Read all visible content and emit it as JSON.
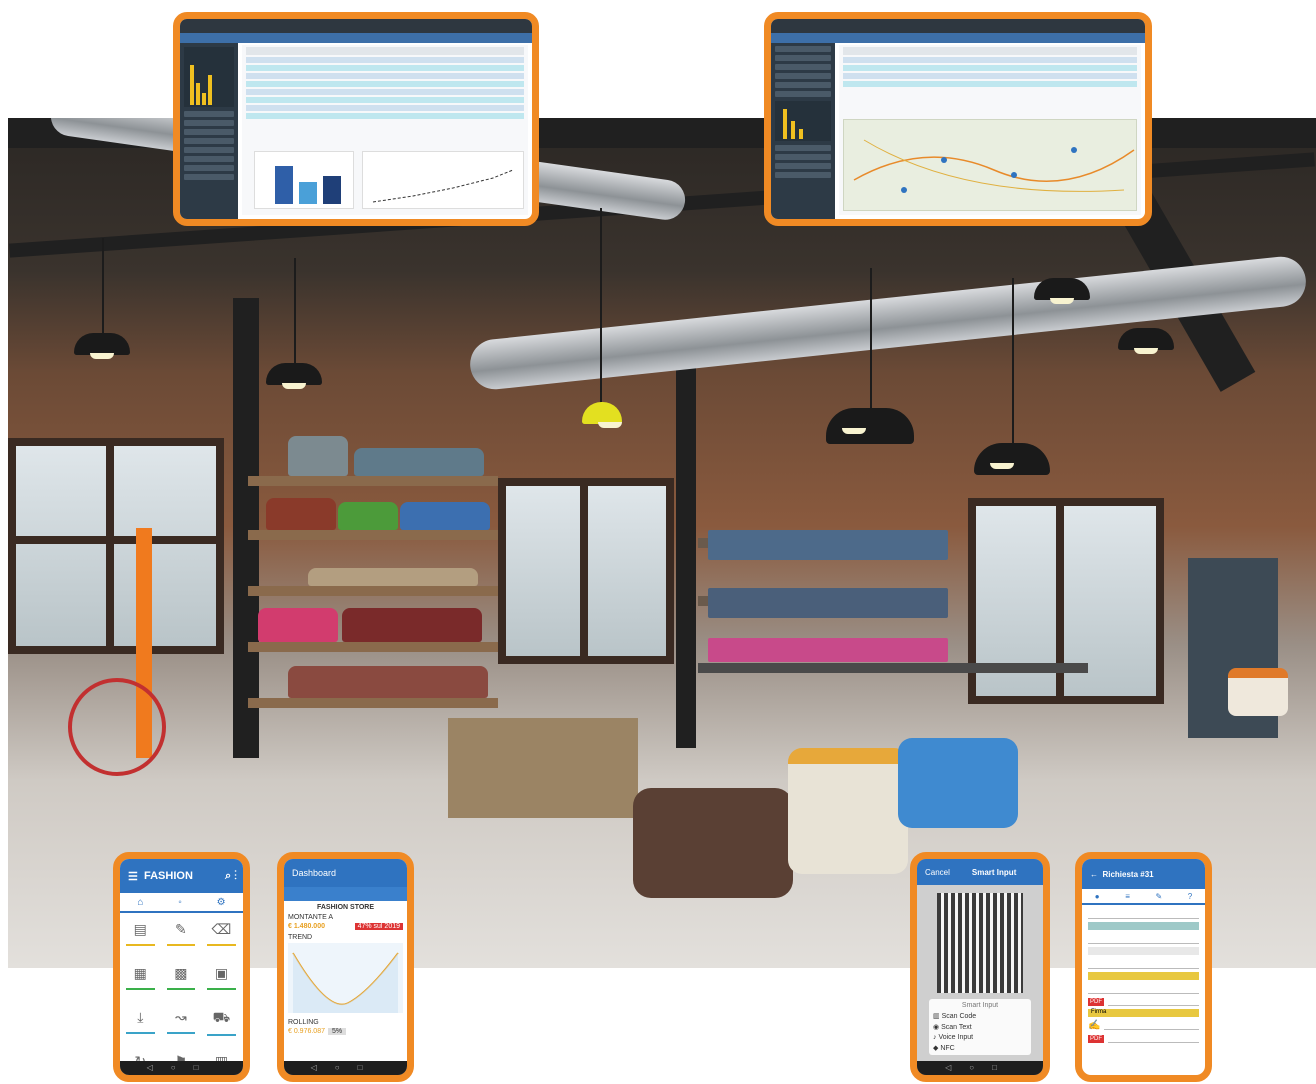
{
  "fashion_app": {
    "title": "FASHION"
  },
  "dashboard_app": {
    "title": "Dashboard",
    "store_title": "FASHION STORE",
    "row1_label": "MONTANTE A",
    "row1_value": "€ 1.480.000",
    "row1_badge": "47% sul 2019",
    "trend_label": "TREND",
    "bottom_label": "ROLLING",
    "bottom_value": "€ 0.976.087",
    "bottom_pct": "5%"
  },
  "smart_input_app": {
    "cancel_label": "Cancel",
    "title": "Smart Input",
    "menu_title": "Smart Input",
    "menu_items": [
      "Scan Code",
      "Scan Text",
      "Voice Input",
      "NFC"
    ]
  },
  "request_app": {
    "title": "Richiesta #31",
    "pdf_label": "PDF",
    "firma_label": "Firma"
  },
  "colors": {
    "accent_frame": "#f08a24",
    "app_blue": "#2f73c0",
    "teal": "#3aa3c8"
  }
}
